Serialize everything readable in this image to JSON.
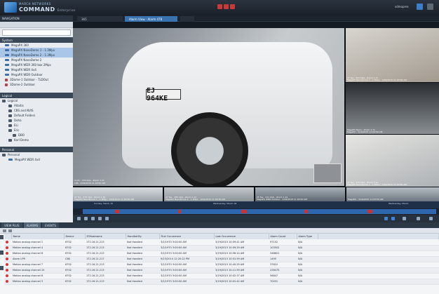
{
  "titlebar": {
    "brand_line1": "MARCH NETWORKS",
    "brand_line2": "COMMAND",
    "brand_sub": "Enterprise",
    "user": "sdmopres"
  },
  "tabs": [
    {
      "label": "365"
    },
    {
      "label": "Alarm View - Alarm 478"
    },
    {
      "label": ""
    }
  ],
  "nav": {
    "header": "NAVIGATION",
    "system_label": "System",
    "system_items": [
      "MegaPX 360",
      "MegaPX NanoDome 1 - 1.3Mpx",
      "MegaPX NanoDome 2 - 1.3Mpx",
      "MegaPX NanoDome 2",
      "MegaPX WDR 360 box 2Mpx",
      "MegaPX WDR 4x4",
      "MegaPX WDR Outdoor",
      "3Dome-1 Outdoor - TLDOut",
      "3Dome-2 Outdoor"
    ],
    "logical_header": "Logical",
    "logical_root": "Logical",
    "logical_items": [
      "Altaitis",
      "CBS and NVIS",
      "Default Folders",
      "Doha",
      "ELi",
      "Eric",
      "DBO",
      "Karl Demo"
    ],
    "personal_header": "Personal",
    "personal_root": "Personal",
    "personal_items": [
      "MegaPX WDR 4x4"
    ]
  },
  "cameras": {
    "main_plate": "EJ 964KE",
    "main_overlay_1": "4 pm - 715 kb/s - Zoom 1.7x",
    "main_overlay_2": "LPR - 3/19/2015 11:03:50 AM",
    "c1": "27 fps - 953 kb/s - Zoom 1.7x",
    "c1b": "MegaPX NanoDome 2 - 1.3Mpx - 3/19/2015 11:03:50 AM",
    "c2": "MegaPX Nano - Zoom 1.7x",
    "c2b": "MegaPX - 3/19/2015 11:03:50 AM",
    "c3": "27 fps - 475 kb/s - Zoom 3.1x",
    "c3b": "MegaPX NanoDome 1 - 1.3Mpx - 3/19/2015 11:03:50 AM",
    "b1": "27 fps - 475 kb/s - Zoom 1.3x",
    "b1b": "MegaPX NanoDome 1 - 1.3Mpx - 3/19/2015 11:03:50 AM",
    "b2": "27 fps - 365 kb/s - Zoom 1.2x",
    "b2b": "MegaPX NanoDome 2 - 1.3Mpx - 3/19/2015 11:03:50 AM",
    "b3": "25 fps - 311 kb/s - Zoom 1.2x",
    "b3b": "MegaPX WDR Outdoor - 3/19/2015 11:03:50 AM",
    "b4": "MegaPX - 3/19/2015 11:03:50 AM",
    "b4b": ""
  },
  "timeline": {
    "left_label": "Sunday, March 15",
    "mid_label": "Wednesday, March 18",
    "right_label": "Wednesday, March"
  },
  "bottom": {
    "tabs": [
      "VIEW PLUS",
      "ALARMS",
      "EVENTS"
    ],
    "columns": [
      "Name",
      "Device",
      "IP/Hostname",
      "Handled By",
      "First Occurrence",
      "Last Occurrence",
      "Alarm Count",
      "Alarm Type"
    ],
    "rows": [
      [
        "Motion analog channel 1",
        "6702",
        "172.16.21.213",
        "Not Handled",
        "3/2/1970 3:00:00 AM",
        "3/19/2015 10:59:41 AM",
        "97152",
        "N/A"
      ],
      [
        "Motion analog channel 4",
        "6702",
        "172.16.21.213",
        "Not Handled",
        "3/2/1970 3:00:00 AM",
        "3/19/2015 10:59:29 AM",
        "103502",
        "N/A"
      ],
      [
        "Motion analog channel 8",
        "6702",
        "172.16.21.213",
        "Not Handled",
        "3/2/1970 3:00:00 AM",
        "3/19/2015 10:56:14 AM",
        "348601",
        "N/A"
      ],
      [
        "Alarm LPR",
        "CBS",
        "172.16.21.217",
        "Not Handled",
        "9/23/2014 12:20:22 PM",
        "3/19/2015 10:51:59 AM",
        "1495",
        "N/A"
      ],
      [
        "Motion analog channel 7",
        "6702",
        "172.16.21.213",
        "Not Handled",
        "3/2/1970 3:00:00 AM",
        "3/19/2015 10:40:29 AM",
        "37610",
        "N/A"
      ],
      [
        "Motion analog channel 10",
        "6702",
        "172.16.21.213",
        "Not Handled",
        "3/2/1970 3:00:00 AM",
        "3/19/2015 10:11:59 AM",
        "228470",
        "N/A"
      ],
      [
        "Motion analog channel 6",
        "6702",
        "172.16.21.213",
        "Not Handled",
        "3/2/1970 3:00:00 AM",
        "3/19/2015 10:02:37 AM",
        "56847",
        "N/A"
      ],
      [
        "Motion analog channel 3",
        "6702",
        "172.16.21.213",
        "Not Handled",
        "3/2/1970 3:00:00 AM",
        "3/19/2015 10:01:42 AM",
        "70431",
        "N/A"
      ]
    ]
  }
}
